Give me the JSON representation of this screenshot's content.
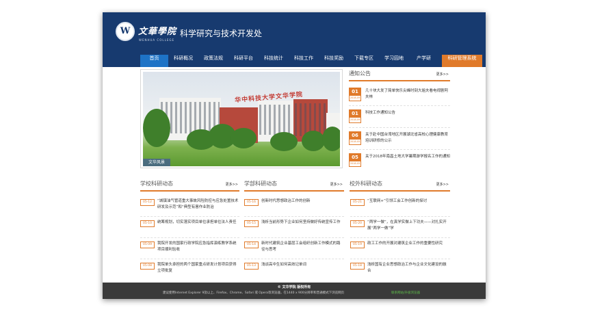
{
  "header": {
    "logo_cn": "文華學院",
    "logo_en": "WENHUA COLLEGE",
    "logo_mark": "W",
    "site_title": "科学研究与技术开发处"
  },
  "nav": [
    {
      "label": "首页"
    },
    {
      "label": "科研概况"
    },
    {
      "label": "政策法规"
    },
    {
      "label": "科研平台"
    },
    {
      "label": "科技统计"
    },
    {
      "label": "科技工作"
    },
    {
      "label": "科技奖励"
    },
    {
      "label": "下载专区"
    },
    {
      "label": "学习园地"
    },
    {
      "label": "产学研"
    },
    {
      "label": "科研管理系统"
    }
  ],
  "hero": {
    "caption": "文华风景",
    "sign_text": "华中科技大学文华学院"
  },
  "notice": {
    "title": "通知公告",
    "more": "更多>>",
    "items": [
      {
        "day": "01",
        "ym": "2018-09",
        "text": "几十块大发了简单快乐尖峰时刻大姐夫看电视剧阿夫林"
      },
      {
        "day": "01",
        "ym": "2018-09",
        "text": "科技工作通知公告"
      },
      {
        "day": "06",
        "ym": "2018-05",
        "text": "关于赴中国台湾地区开展湖北省高校心理健康教育培训研修的公示"
      },
      {
        "day": "05",
        "ym": "2018-05",
        "text": "关于2018年南昌土地大学暑期游学报名工作的通知"
      }
    ]
  },
  "school": {
    "title": "学校科研动态",
    "more": "更多>>",
    "items": [
      {
        "date": "05-12",
        "text": "“城镇油气管道重大事故风险防控与应急处置技术研发及示范”和“典型有害作业防治"
      },
      {
        "date": "05-10",
        "text": "统筹规划，切实落实项目单位承担单位法人责任"
      },
      {
        "date": "05-09",
        "text": "我院开发的国家行政学院应急指挥演练教学系统项目顺利验收"
      },
      {
        "date": "05-08",
        "text": "我院单头承担的两个国家重点研发计划项目获得立项批复"
      }
    ]
  },
  "dept": {
    "title": "学部科研动态",
    "more": "更多>>",
    "items": [
      {
        "date": "05-16",
        "text": "创新时代思想政治工作的创新"
      },
      {
        "date": "05-15",
        "text": "浅析当前形势下企业如何坚持做好传统宣传工作"
      },
      {
        "date": "05-14",
        "text": "新时代建筑企业基层工会组织创新工作模式的路径与思考"
      },
      {
        "date": "05-13",
        "text": "浅谈高中生如何高效记单词"
      }
    ]
  },
  "external": {
    "title": "校外科研动态",
    "more": "更多>>",
    "items": [
      {
        "date": "05-21",
        "text": "“互联网+”引领工会工作创新的探讨"
      },
      {
        "date": "05-20",
        "text": "“两学一做”，在真学实做上下功夫——对扎实开展“两学一做”学"
      },
      {
        "date": "05-19",
        "text": "政工工作的开展对建筑企业工作的重要性研究"
      },
      {
        "date": "05-18",
        "text": "浅析国有企业思想政治工作与企业文化建设的融合"
      }
    ]
  },
  "footer": {
    "copyright": "© 文华学院  版权所有",
    "browser_note": "建议使用Internet Explorer 9及以上、Firefox、Chrome、Safari 或 Opera等浏览器，在1440 x 900分辨率和普通模式下浏览网页",
    "link": "联系网站/升级浏览器"
  },
  "colors": {
    "header_bg": "#173a6f",
    "nav_active": "#1e73c6",
    "accent_orange": "#e07a2a",
    "footer_bg": "#3a3a3a"
  }
}
